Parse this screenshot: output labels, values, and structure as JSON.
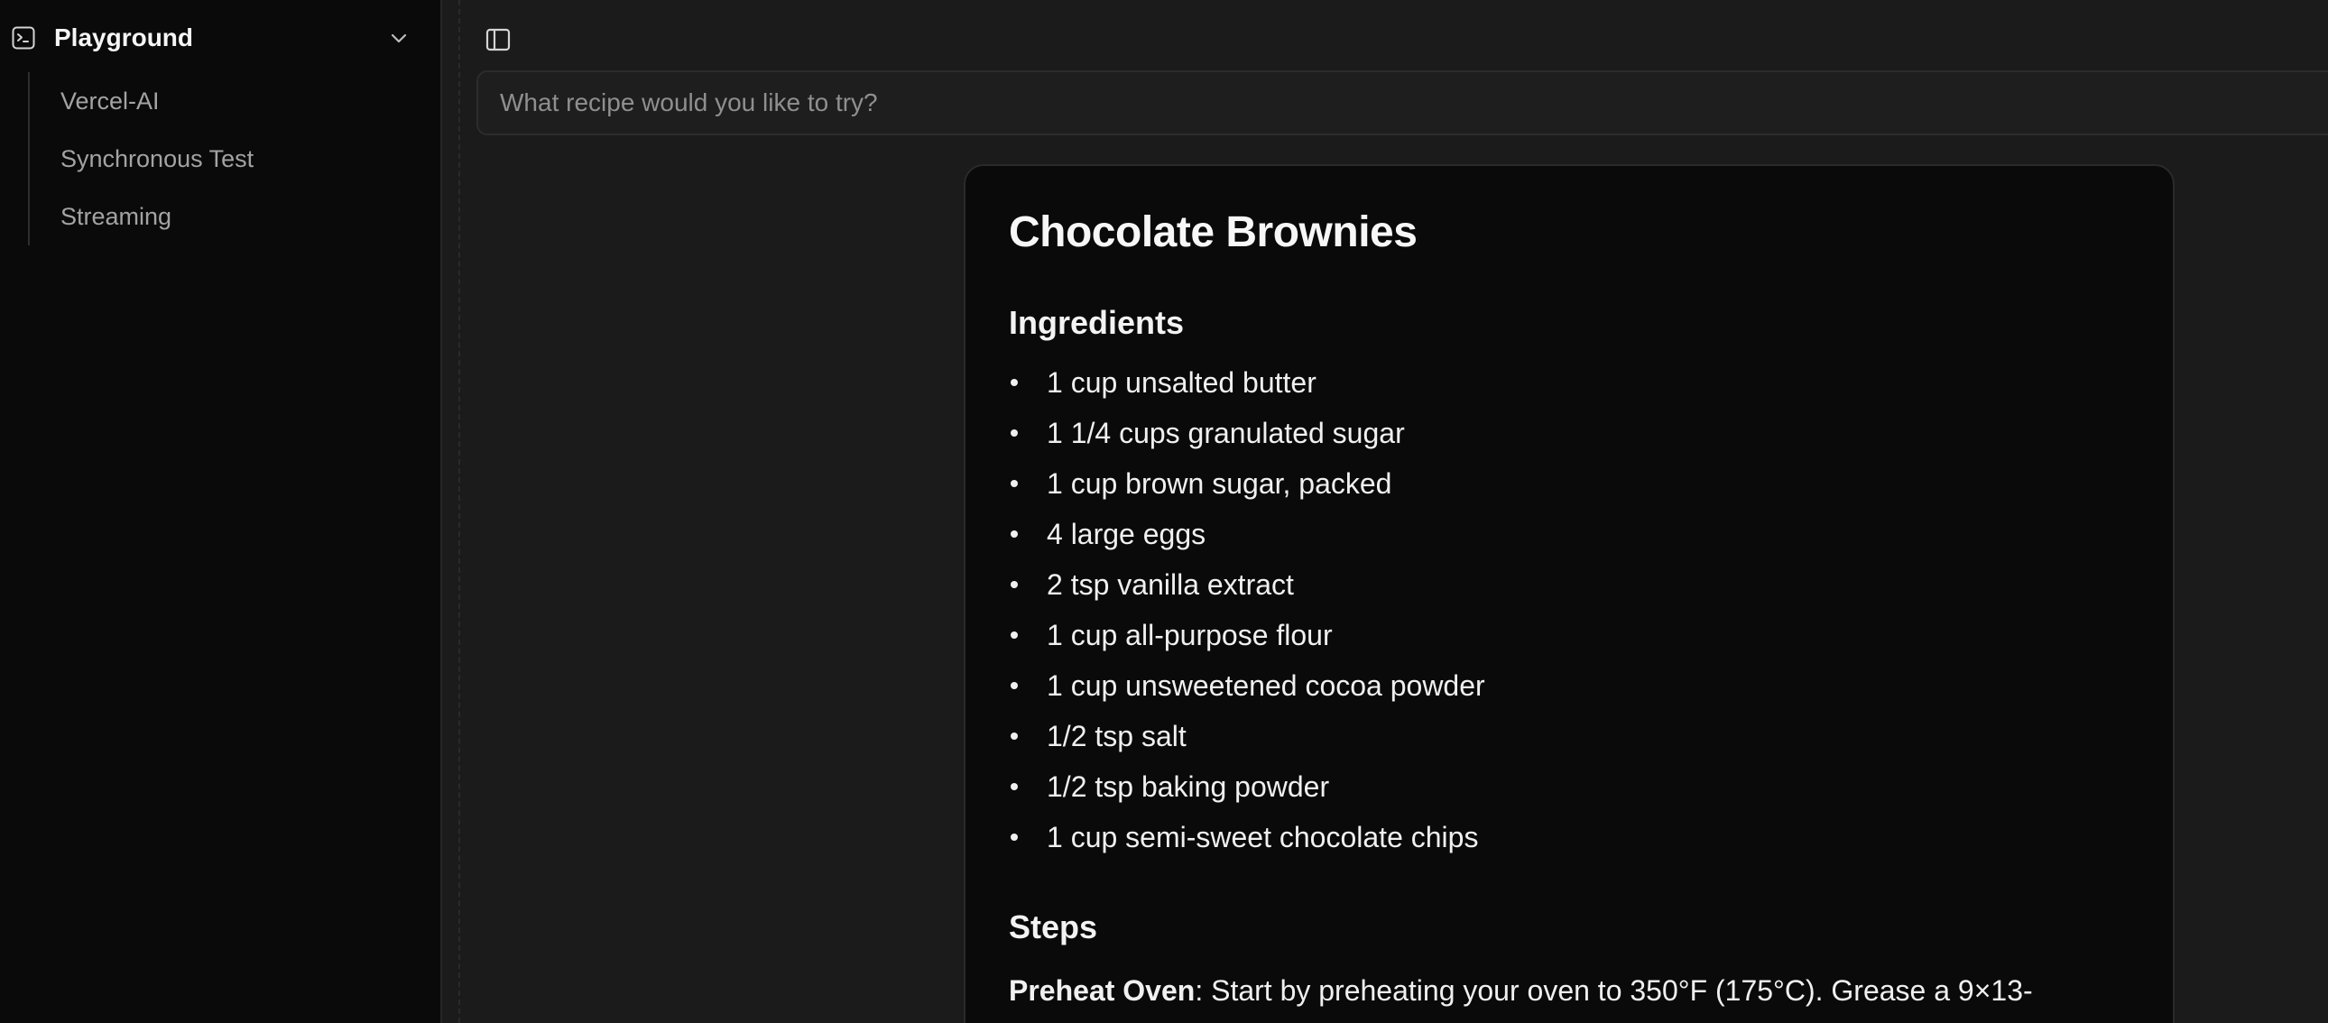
{
  "sidebar": {
    "title": "Playground",
    "items": [
      {
        "label": "Vercel-AI"
      },
      {
        "label": "Synchronous Test"
      },
      {
        "label": "Streaming"
      }
    ]
  },
  "main": {
    "prompt_placeholder": "What recipe would you like to try?"
  },
  "recipe": {
    "title": "Chocolate Brownies",
    "ingredients_heading": "Ingredients",
    "ingredients": [
      "1 cup unsalted butter",
      "1 1/4 cups granulated sugar",
      "1 cup brown sugar, packed",
      "4 large eggs",
      "2 tsp vanilla extract",
      "1 cup all-purpose flour",
      "1 cup unsweetened cocoa powder",
      "1/2 tsp salt",
      "1/2 tsp baking powder",
      "1 cup semi-sweet chocolate chips"
    ],
    "steps_heading": "Steps",
    "steps": [
      {
        "title": "Preheat Oven",
        "text": ": Start by preheating your oven to 350°F (175°C). Grease a 9×13-"
      }
    ]
  },
  "colors": {
    "sidebar_bg": "#0a0a0a",
    "main_bg": "#1b1b1b",
    "card_bg": "#0a0a0a"
  }
}
